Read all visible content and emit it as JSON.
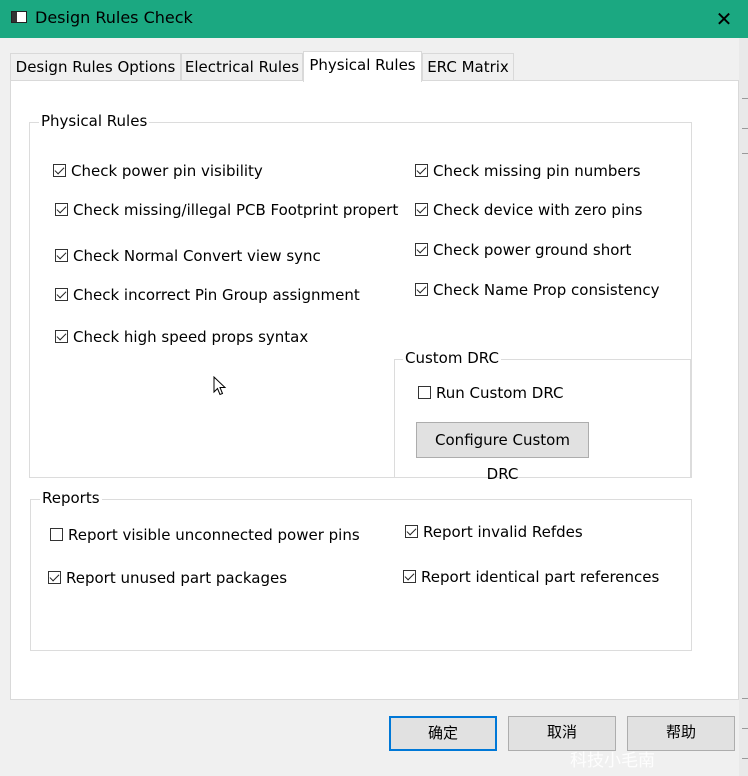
{
  "window": {
    "title": "Design Rules Check"
  },
  "tabs": [
    {
      "label": "Design Rules Options"
    },
    {
      "label": "Electrical Rules"
    },
    {
      "label": "Physical Rules"
    },
    {
      "label": "ERC Matrix"
    }
  ],
  "physical_rules": {
    "legend": "Physical Rules",
    "left": [
      {
        "label": "Check power pin visibility",
        "checked": true
      },
      {
        "label": "Check missing/illegal PCB Footprint property",
        "checked": true
      },
      {
        "label": "Check Normal Convert view sync",
        "checked": true
      },
      {
        "label": "Check incorrect Pin Group assignment",
        "checked": true
      },
      {
        "label": "Check high speed props syntax",
        "checked": true
      }
    ],
    "right": [
      {
        "label": "Check missing pin numbers",
        "checked": true
      },
      {
        "label": "Check device with zero pins",
        "checked": true
      },
      {
        "label": "Check power ground short",
        "checked": true
      },
      {
        "label": "Check Name Prop consistency",
        "checked": true
      }
    ]
  },
  "custom_drc": {
    "legend": "Custom DRC",
    "run_label": "Run Custom DRC",
    "run_checked": false,
    "configure_label": "Configure Custom DRC"
  },
  "reports": {
    "legend": "Reports",
    "items": [
      {
        "label": "Report visible unconnected power pins",
        "checked": false
      },
      {
        "label": "Report invalid Refdes",
        "checked": true
      },
      {
        "label": "Report unused part packages",
        "checked": true
      },
      {
        "label": "Report identical part references",
        "checked": true
      }
    ]
  },
  "footer": {
    "ok": "确定",
    "cancel": "取消",
    "help": "帮助"
  },
  "watermark": "科技小毛南",
  "icons": {
    "close": "close-icon",
    "app": "window-icon",
    "cursor": "mouse-pointer-icon"
  },
  "colors": {
    "titlebar": "#1ba881",
    "default_button_border": "#0078d7"
  }
}
